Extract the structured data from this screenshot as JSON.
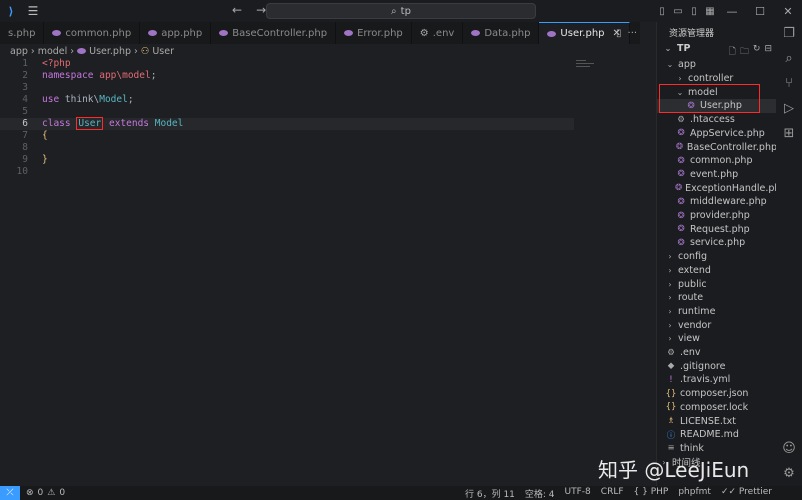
{
  "titlebar": {
    "search": "tp"
  },
  "tabs": [
    {
      "label": "s.php",
      "active": false
    },
    {
      "label": "common.php",
      "active": false
    },
    {
      "label": "app.php",
      "active": false
    },
    {
      "label": "BaseController.php",
      "active": false
    },
    {
      "label": "Error.php",
      "active": false
    },
    {
      "label": ".env",
      "active": false
    },
    {
      "label": "Data.php",
      "active": false
    },
    {
      "label": "User.php",
      "active": true
    }
  ],
  "breadcrumb": {
    "p1": "app",
    "p2": "model",
    "p3": "User.php",
    "p4": "User"
  },
  "editor": {
    "lines": [
      {
        "n": "1"
      },
      {
        "n": "2"
      },
      {
        "n": "3"
      },
      {
        "n": "4"
      },
      {
        "n": "5"
      },
      {
        "n": "6"
      },
      {
        "n": "7"
      },
      {
        "n": "8"
      },
      {
        "n": "9"
      },
      {
        "n": "10"
      }
    ],
    "code": {
      "php_open": "<?php",
      "namespace_kw": "namespace",
      "namespace_val": "app\\model",
      "semi": ";",
      "use_kw": "use",
      "use_val_a": "think\\",
      "use_val_b": "Model",
      "class_kw": "class",
      "class_name": "User",
      "extends_kw": "extends",
      "parent": "Model",
      "brace_open": "{",
      "brace_close": "}"
    }
  },
  "explorer": {
    "title": "资源管理器",
    "root": "TP",
    "items": [
      {
        "label": "app",
        "type": "folder-open",
        "level": 0
      },
      {
        "label": "controller",
        "type": "folder",
        "level": 1
      },
      {
        "label": "model",
        "type": "folder-open",
        "level": 1
      },
      {
        "label": "User.php",
        "type": "php",
        "level": 2,
        "selected": true
      },
      {
        "label": ".htaccess",
        "type": "gear",
        "level": 1
      },
      {
        "label": "AppService.php",
        "type": "php",
        "level": 1
      },
      {
        "label": "BaseController.php",
        "type": "php",
        "level": 1
      },
      {
        "label": "common.php",
        "type": "php",
        "level": 1
      },
      {
        "label": "event.php",
        "type": "php",
        "level": 1
      },
      {
        "label": "ExceptionHandle.php",
        "type": "php",
        "level": 1
      },
      {
        "label": "middleware.php",
        "type": "php",
        "level": 1
      },
      {
        "label": "provider.php",
        "type": "php",
        "level": 1
      },
      {
        "label": "Request.php",
        "type": "php",
        "level": 1
      },
      {
        "label": "service.php",
        "type": "php",
        "level": 1
      },
      {
        "label": "config",
        "type": "folder",
        "level": 0
      },
      {
        "label": "extend",
        "type": "folder",
        "level": 0
      },
      {
        "label": "public",
        "type": "folder",
        "level": 0
      },
      {
        "label": "route",
        "type": "folder",
        "level": 0
      },
      {
        "label": "runtime",
        "type": "folder",
        "level": 0
      },
      {
        "label": "vendor",
        "type": "folder",
        "level": 0
      },
      {
        "label": "view",
        "type": "folder",
        "level": 0
      },
      {
        "label": ".env",
        "type": "gear",
        "level": 0
      },
      {
        "label": ".gitignore",
        "type": "git",
        "level": 0
      },
      {
        "label": ".travis.yml",
        "type": "yml",
        "level": 0
      },
      {
        "label": "composer.json",
        "type": "json",
        "level": 0
      },
      {
        "label": "composer.lock",
        "type": "json",
        "level": 0
      },
      {
        "label": "LICENSE.txt",
        "type": "txt",
        "level": 0
      },
      {
        "label": "README.md",
        "type": "md",
        "level": 0
      },
      {
        "label": "think",
        "type": "file",
        "level": 0
      },
      {
        "label": "时间线",
        "type": "folder",
        "level": -1
      }
    ]
  },
  "statusbar": {
    "errors": "0",
    "warnings": "0",
    "position": "行 6，列 11",
    "spaces": "空格: 4",
    "encoding": "UTF-8",
    "eol": "CRLF",
    "language": "PHP",
    "formatter": "phpfmt",
    "prettier": "Prettier"
  },
  "watermark": "知乎 @LeeJiEun"
}
